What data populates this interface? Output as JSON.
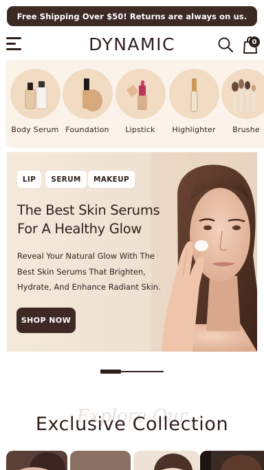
{
  "announcement": {
    "text": "Free Shipping Over $50! Returns are always on us."
  },
  "header": {
    "logo": "DYNAMIC",
    "cart_count": "0",
    "icons": {
      "menu": "hamburger-menu-icon",
      "search": "search-icon",
      "cart": "shopping-bag-icon"
    }
  },
  "categories": [
    {
      "label": "Body Serum"
    },
    {
      "label": "Foundation"
    },
    {
      "label": "Lipstick"
    },
    {
      "label": "Highlighter"
    },
    {
      "label": "Brushe"
    }
  ],
  "hero": {
    "tags": [
      "LIP",
      "SERUM",
      "MAKEUP"
    ],
    "title_line1": "The Best Skin Serums",
    "title_line2": "For A Healthy Glow",
    "desc_line1": "Reveal Your Natural Glow With The",
    "desc_line2": "Best Skin Serums That Brighten,",
    "desc_line3": "Hydrate, And Enhance Radiant Skin.",
    "button": "SHOP NOW"
  },
  "collection": {
    "background_text": "Explore Our",
    "title": "Exclusive Collection"
  },
  "colors": {
    "primary": "#3d2a24",
    "category_bg": "#fbf3ea",
    "circle_bg": "#f1dcc3"
  }
}
